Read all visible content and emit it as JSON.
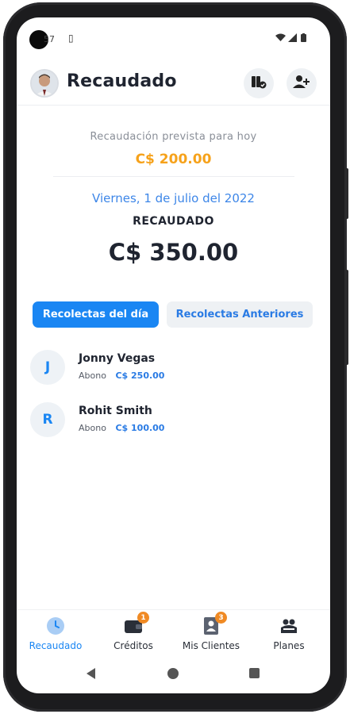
{
  "status_bar": {
    "time": "57"
  },
  "header": {
    "title": "Recaudado",
    "avatar": "user-photo",
    "icons": [
      "cash-check-icon",
      "add-user-icon"
    ]
  },
  "summary": {
    "prevista_label": "Recaudación prevista para hoy",
    "prevista_value": "C$ 200.00",
    "date": "Viernes, 1 de julio del 2022",
    "recaudado_label": "RECAUDADO",
    "recaudado_value": "C$ 350.00"
  },
  "tabs": [
    {
      "label": "Recolectas del día",
      "active": true
    },
    {
      "label": "Recolectas Anteriores",
      "active": false
    }
  ],
  "collections": [
    {
      "initial": "J",
      "name": "Jonny Vegas",
      "type": "Abono",
      "amount": "C$ 250.00"
    },
    {
      "initial": "R",
      "name": "Rohit Smith",
      "type": "Abono",
      "amount": "C$ 100.00"
    }
  ],
  "bottom_nav": [
    {
      "label": "Recaudado",
      "icon": "clock-icon",
      "active": true
    },
    {
      "label": "Créditos",
      "icon": "wallet-icon",
      "badge": "1"
    },
    {
      "label": "Mis Clientes",
      "icon": "contacts-icon",
      "badge": "3"
    },
    {
      "label": "Planes",
      "icon": "plans-icon"
    }
  ],
  "colors": {
    "accent": "#1a86f3",
    "warning": "#f6a21b",
    "badge": "#f08a24",
    "text": "#1f2430"
  }
}
